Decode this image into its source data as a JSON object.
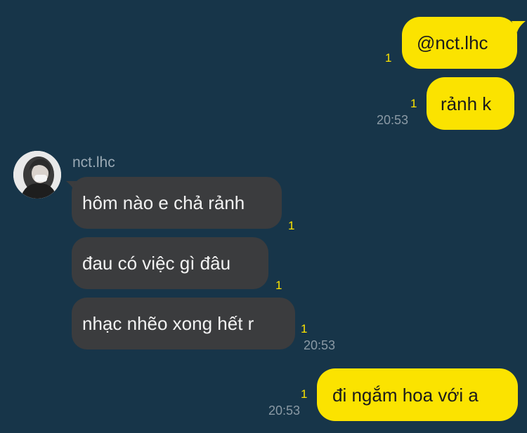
{
  "colors": {
    "background": "#173549",
    "outgoing_bubble": "#FBE300",
    "incoming_bubble": "#3B3C3E",
    "read_count": "#FBE300",
    "timestamp": "#8B9AA5"
  },
  "messages": {
    "out1": {
      "text": "@nct.lhc",
      "unread": "1"
    },
    "out2": {
      "text": "rảnh k",
      "unread": "1",
      "time": "20:53"
    },
    "incoming": {
      "sender": "nct.lhc",
      "avatar_icon": "profile-photo-icon",
      "m1": {
        "text": "hôm nào e chả rảnh",
        "unread": "1"
      },
      "m2": {
        "text": "đau có việc gì đâu",
        "unread": "1"
      },
      "m3": {
        "text": "nhạc nhẽo xong hết r",
        "unread": "1",
        "time": "20:53"
      }
    },
    "out3": {
      "text": "đi ngắm hoa với a",
      "unread": "1",
      "time": "20:53"
    }
  }
}
